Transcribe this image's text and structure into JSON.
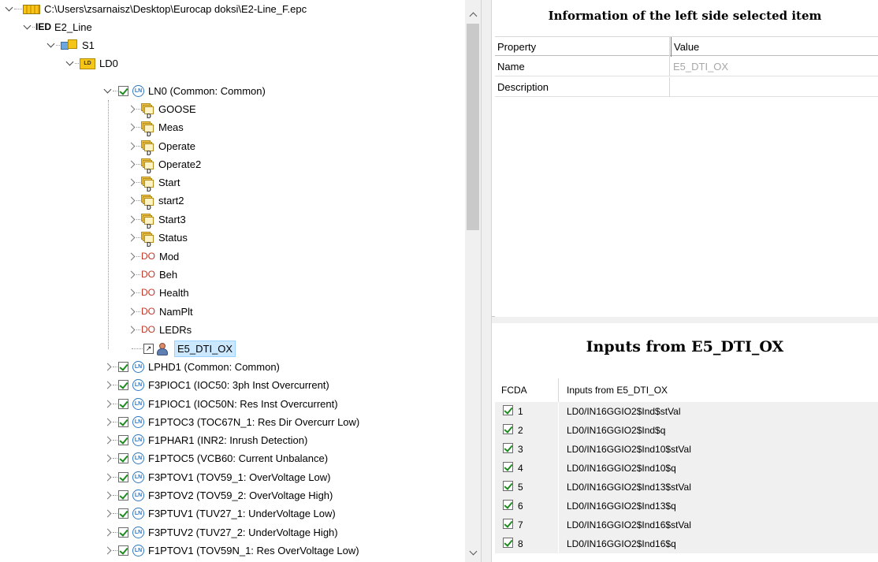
{
  "tree": {
    "root_path": "C:\\Users\\zsarnaisz\\Desktop\\Eurocap doksi\\E2-Line_F.epc",
    "ied_tag": "IED",
    "ied_name": "E2_Line",
    "server": "S1",
    "ld_tag": "LD",
    "ld_name": "LD0",
    "ln_tag": "LN",
    "ds_tag": "D",
    "do_tag": "DO",
    "ln0": "LN0 (Common: Common)",
    "datasets": [
      "GOOSE",
      "Meas",
      "Operate",
      "Operate2",
      "Start",
      "start2",
      "Start3",
      "Status"
    ],
    "data_objects": [
      "Mod",
      "Beh",
      "Health",
      "NamPlt",
      "LEDRs"
    ],
    "ext_ref": "E5_DTI_OX",
    "logical_nodes": [
      "LPHD1 (Common: Common)",
      "F3PIOC1 (IOC50: 3ph Inst Overcurrent)",
      "F1PIOC1 (IOC50N: Res Inst Overcurrent)",
      "F1PTOC3 (TOC67N_1: Res Dir Overcurr Low)",
      "F1PHAR1 (INR2: Inrush Detection)",
      "F1PTOC5 (VCB60: Current Unbalance)",
      "F3PTOV1 (TOV59_1: OverVoltage Low)",
      "F3PTOV2 (TOV59_2: OverVoltage High)",
      "F3PTUV1 (TUV27_1: UnderVoltage Low)",
      "F3PTUV2 (TUV27_2: UnderVoltage High)",
      "F1PTOV1 (TOV59N_1: Res OverVoltage Low)"
    ]
  },
  "info": {
    "title": "Information of the left side selected item",
    "col_property": "Property",
    "col_value": "Value",
    "rows": [
      {
        "property": "Name",
        "value": "E5_DTI_OX"
      },
      {
        "property": "Description",
        "value": ""
      }
    ]
  },
  "inputs": {
    "title": "Inputs from E5_DTI_OX",
    "col_fcda": "FCDA",
    "col_inputs": "Inputs from E5_DTI_OX",
    "rows": [
      {
        "n": "1",
        "path": "LD0/IN16GGIO2$Ind$stVal"
      },
      {
        "n": "2",
        "path": "LD0/IN16GGIO2$Ind$q"
      },
      {
        "n": "3",
        "path": "LD0/IN16GGIO2$Ind10$stVal"
      },
      {
        "n": "4",
        "path": "LD0/IN16GGIO2$Ind10$q"
      },
      {
        "n": "5",
        "path": "LD0/IN16GGIO2$Ind13$stVal"
      },
      {
        "n": "6",
        "path": "LD0/IN16GGIO2$Ind13$q"
      },
      {
        "n": "7",
        "path": "LD0/IN16GGIO2$Ind16$stVal"
      },
      {
        "n": "8",
        "path": "LD0/IN16GGIO2$Ind16$q"
      }
    ]
  }
}
